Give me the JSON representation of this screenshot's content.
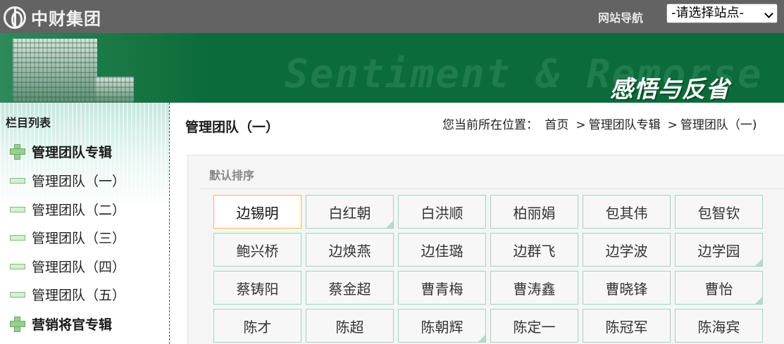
{
  "header": {
    "logo_text": "中财集团",
    "site_nav_label": "网站导航",
    "site_select_value": "-请选择站点-"
  },
  "banner": {
    "watermark": "Sentiment & Remorse",
    "title": "感悟与反省"
  },
  "sidebar": {
    "title": "栏目列表",
    "items": [
      {
        "label": "管理团队专辑",
        "type": "section"
      },
      {
        "label": "管理团队（一）",
        "type": "sub"
      },
      {
        "label": "管理团队（二）",
        "type": "sub"
      },
      {
        "label": "管理团队（三）",
        "type": "sub"
      },
      {
        "label": "管理团队（四）",
        "type": "sub"
      },
      {
        "label": "管理团队（五）",
        "type": "sub"
      },
      {
        "label": "营销将官专辑",
        "type": "section"
      }
    ]
  },
  "main": {
    "page_title": "管理团队（一）",
    "breadcrumb": {
      "prefix": "您当前所在位置：",
      "items": [
        "首页",
        "管理团队专辑",
        "管理团队（一)"
      ],
      "separator": ">"
    },
    "sort_label": "默认排序",
    "names": [
      "边锡明",
      "白红朝",
      "白洪顺",
      "柏丽娟",
      "包其伟",
      "包智钦",
      "鲍兴桥",
      "边焕燕",
      "边佳璐",
      "边群飞",
      "边学波",
      "边学园",
      "蔡铸阳",
      "蔡金超",
      "曹青梅",
      "曹涛鑫",
      "曹晓锋",
      "曹怡",
      "陈才",
      "陈超",
      "陈朝辉",
      "陈定一",
      "陈冠军",
      "陈海宾"
    ]
  },
  "colors": {
    "topbar": "#636363",
    "banner_green": "#0c6b3a",
    "cell_border": "#9fd6c0",
    "active_border": "#f0b860"
  }
}
